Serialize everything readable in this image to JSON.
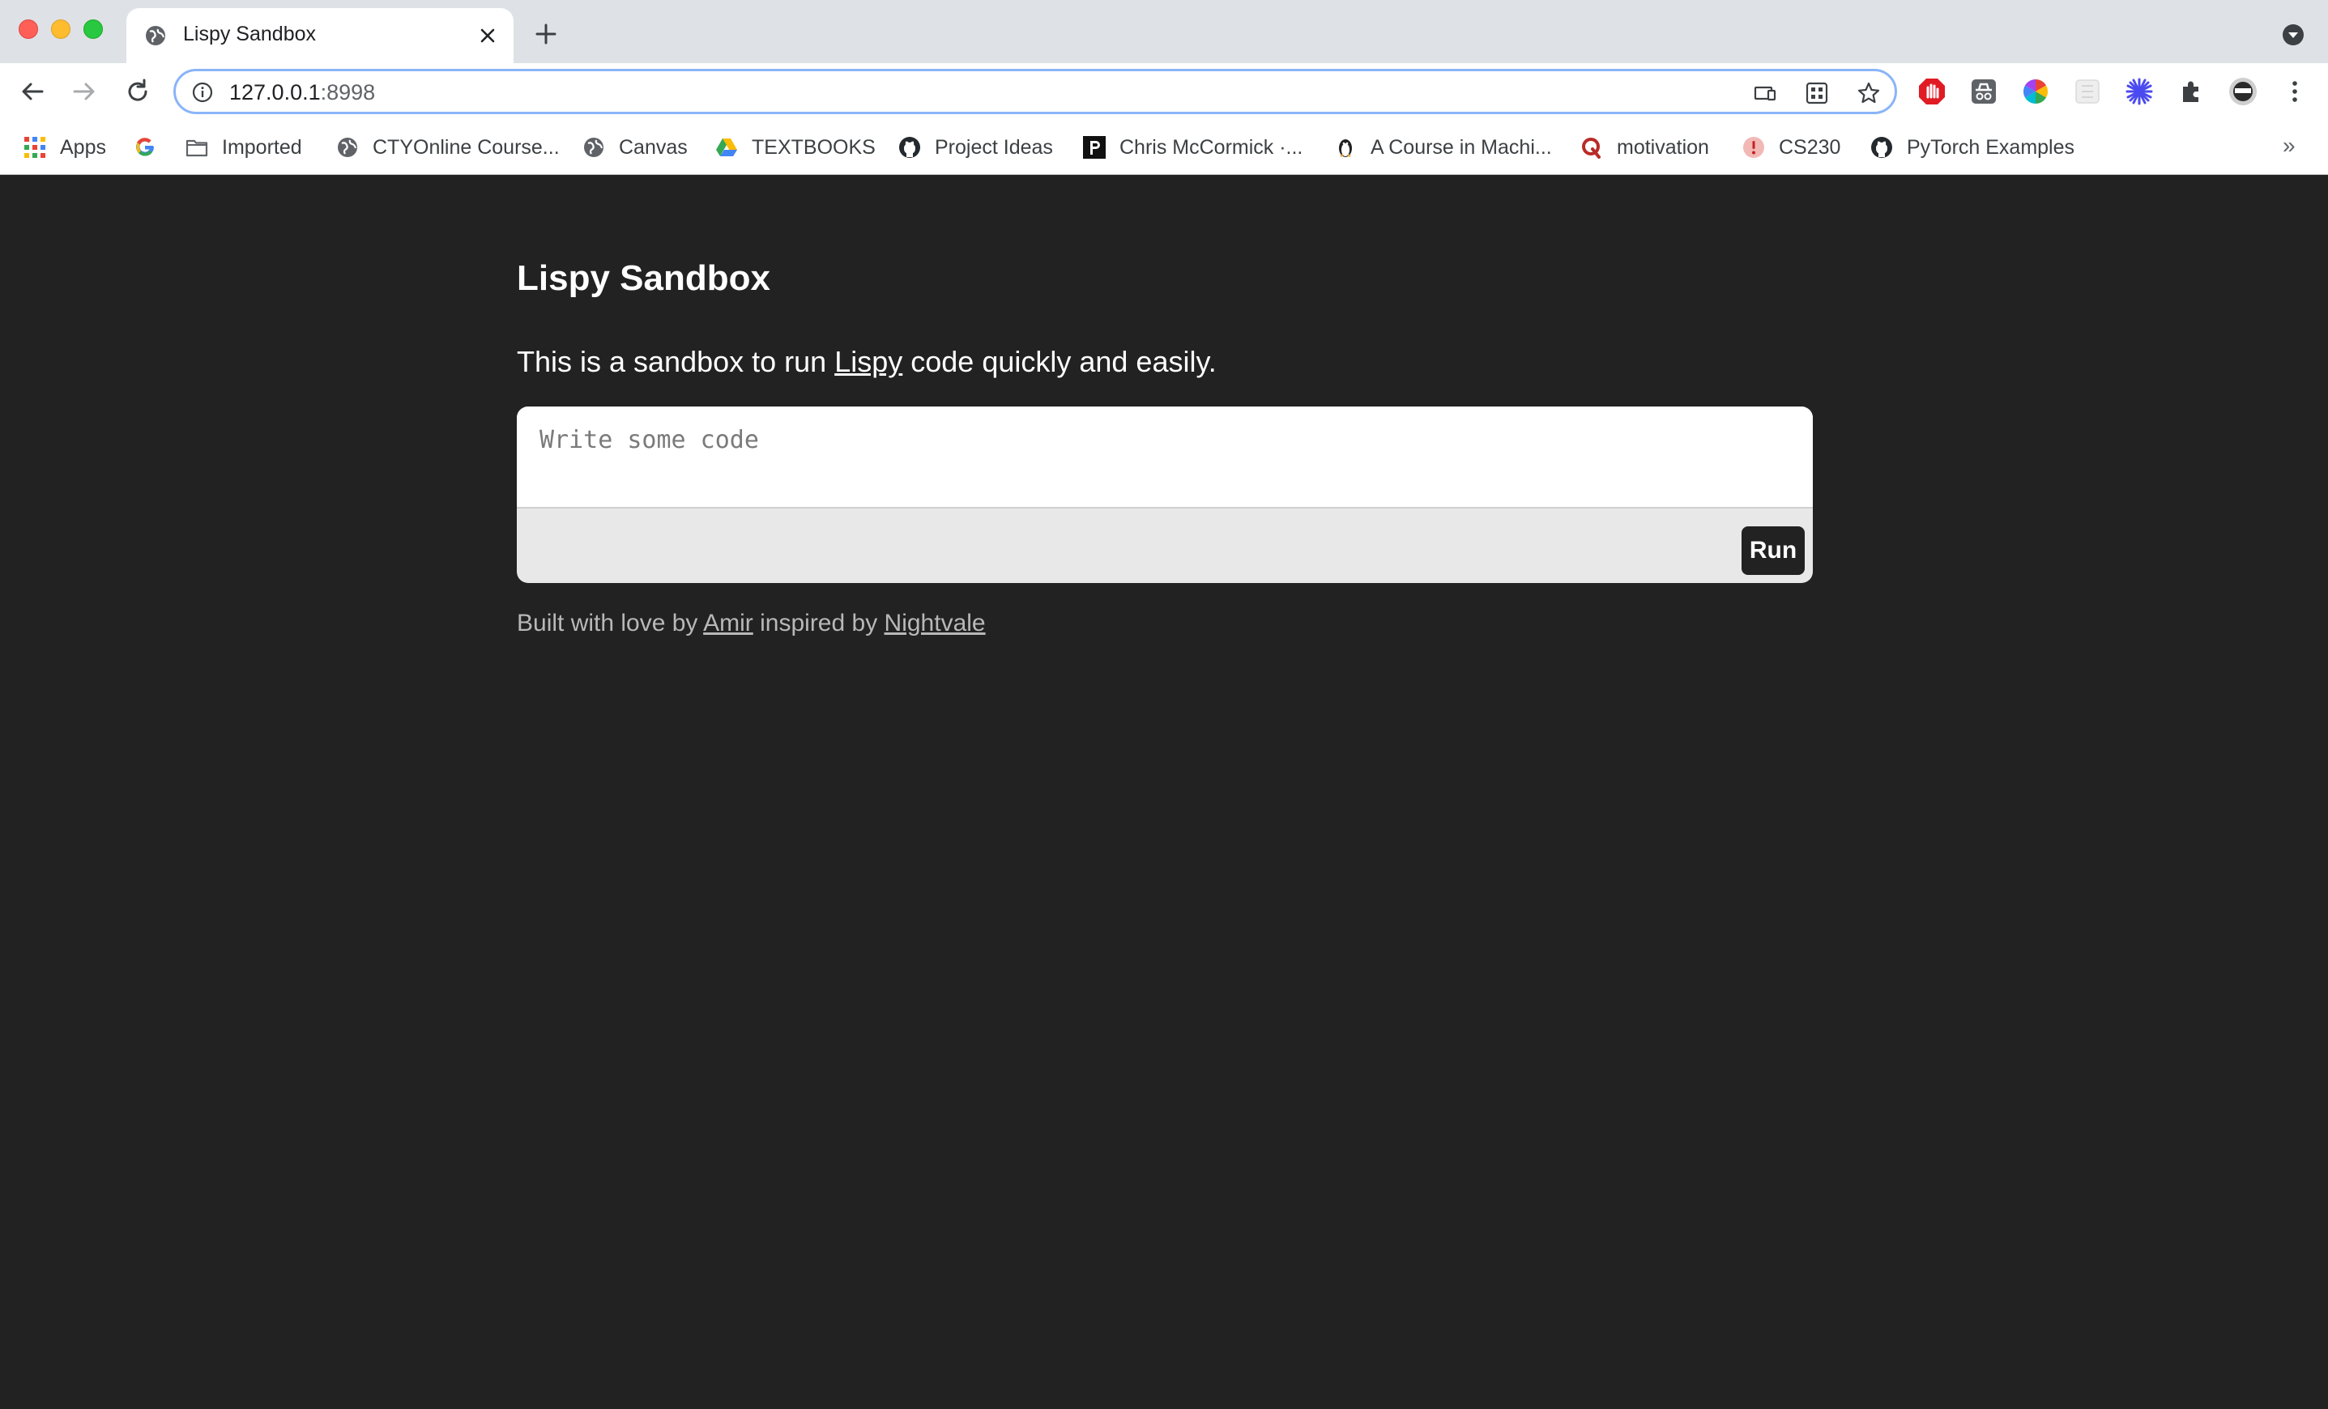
{
  "browser": {
    "tab": {
      "title": "Lispy Sandbox"
    },
    "url": {
      "host": "127.0.0.1",
      "port": ":8998"
    },
    "bookmarks": [
      {
        "label": "Apps",
        "icon": "apps-grid-icon"
      },
      {
        "label": "",
        "icon": "google-icon"
      },
      {
        "label": "Imported",
        "icon": "folder-icon"
      },
      {
        "label": "CTYOnline Course...",
        "icon": "globe-icon"
      },
      {
        "label": "Canvas",
        "icon": "globe-icon"
      },
      {
        "label": "TEXTBOOKS",
        "icon": "google-drive-icon"
      },
      {
        "label": "Project Ideas",
        "icon": "github-icon"
      },
      {
        "label": "Chris McCormick ·...",
        "icon": "p-logo-icon"
      },
      {
        "label": "A Course in Machi...",
        "icon": "penguin-icon"
      },
      {
        "label": "motivation",
        "icon": "quora-icon"
      },
      {
        "label": "CS230",
        "icon": "cs230-icon"
      },
      {
        "label": "PyTorch Examples",
        "icon": "github-icon"
      }
    ],
    "more_bookmarks": "»"
  },
  "page": {
    "title": "Lispy Sandbox",
    "intro": {
      "before": "This is a sandbox to run ",
      "link": "Lispy",
      "after": " code quickly and easily."
    },
    "editor": {
      "placeholder": "Write some code",
      "run_label": "Run"
    },
    "footer": {
      "part1": "Built with love by ",
      "author_link": "Amir",
      "part2": " inspired by ",
      "inspiration_link": "Nightvale"
    }
  },
  "colors": {
    "page_background": "#222222",
    "accent_focus": "#8ab4f8"
  }
}
